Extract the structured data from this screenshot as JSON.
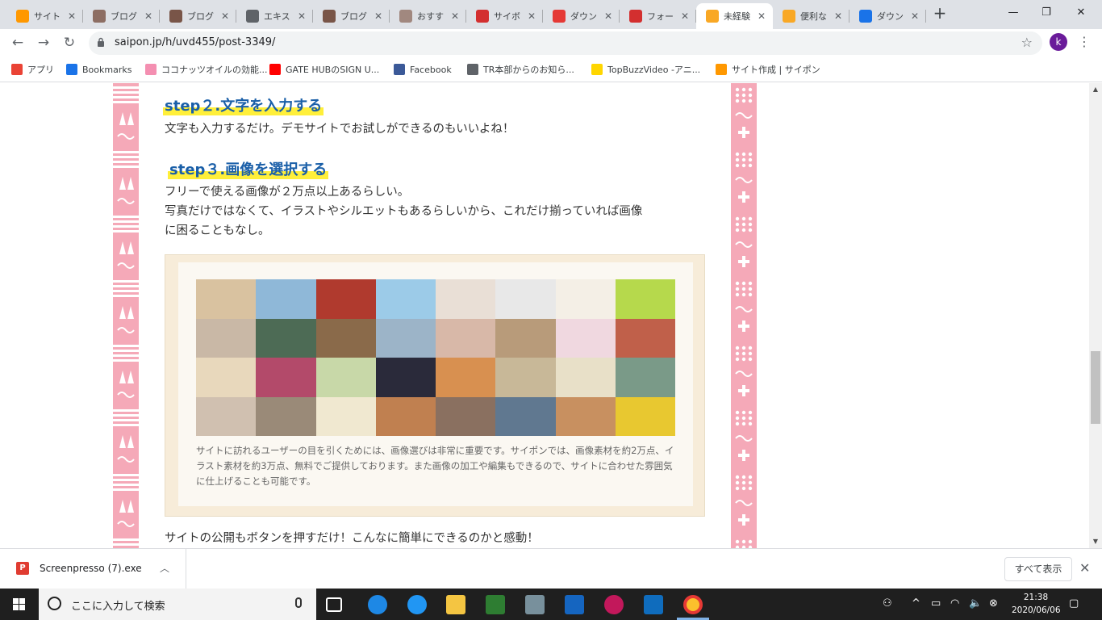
{
  "browser": {
    "tabs": [
      {
        "label": "サイト",
        "color": "#ff9800"
      },
      {
        "label": "ブログ",
        "color": "#8d6e63"
      },
      {
        "label": "ブログ",
        "color": "#795548"
      },
      {
        "label": "エキス",
        "color": "#5f6368"
      },
      {
        "label": "ブログ",
        "color": "#795548"
      },
      {
        "label": "おすす",
        "color": "#a1887f"
      },
      {
        "label": "サイボ",
        "color": "#d32f2f"
      },
      {
        "label": "ダウン",
        "color": "#e53935"
      },
      {
        "label": "フォー",
        "color": "#d32f2f"
      },
      {
        "label": "未経験",
        "color": "#f9a825",
        "active": true
      },
      {
        "label": "便利な",
        "color": "#f9a825"
      },
      {
        "label": "ダウン",
        "color": "#1a73e8"
      }
    ],
    "new_tab": "+",
    "window_controls": {
      "minimize": "—",
      "maximize": "❐",
      "close": "✕"
    },
    "url": "saipon.jp/h/uvd455/post-3349/",
    "profile_initial": "k",
    "bookmarks": [
      {
        "label": "アプリ",
        "icon": "apps-grid-icon",
        "color": "#ea4335"
      },
      {
        "label": "Bookmarks",
        "icon": "star-icon",
        "color": "#1a73e8"
      },
      {
        "label": "ココナッツオイルの効能...",
        "icon": "pig-icon",
        "color": "#f48fb1"
      },
      {
        "label": "GATE HUBのSIGN U...",
        "icon": "youtube-icon",
        "color": "#ff0000"
      },
      {
        "label": "Facebook",
        "icon": "facebook-icon",
        "color": "#3b5998"
      },
      {
        "label": "TR本部からのお知ら...",
        "icon": "globe-icon",
        "color": "#5f6368"
      },
      {
        "label": "TopBuzzVideo -アニ...",
        "icon": "topbuzz-icon",
        "color": "#ffd600"
      },
      {
        "label": "サイト作成 | サイポン",
        "icon": "saipon-icon",
        "color": "#ff9800"
      }
    ]
  },
  "article": {
    "step2_heading": "step２.文字を入力する",
    "step2_text": "文字も入力するだけ。デモサイトでお試しができるのもいいよね！",
    "step3_heading": "step３.画像を選択する",
    "step3_line1": "フリーで使える画像が２万点以上あるらしい。",
    "step3_line2": "写真だけではなくて、イラストやシルエットもあるらしいから、これだけ揃っていれば画像",
    "step3_line3": "に困ることもなし。",
    "figure_caption": "サイトに訪れるユーザーの目を引くためには、画像選びは非常に重要です。サイポンでは、画像素材を約2万点、イラスト素材を約3万点、無料でご提供しております。また画像の加工や編集もできるので、サイトに合わせた雰囲気に仕上げることも可能です。",
    "photo_colors": [
      "#d9c2a0",
      "#8fb8d8",
      "#b03a2e",
      "#9ccbe8",
      "#e9dfd6",
      "#e8e8e8",
      "#f4efe6",
      "#b6d94c",
      "#c9b8a6",
      "#4d6b55",
      "#8a6a4a",
      "#9cb4c8",
      "#d8b8a8",
      "#b89b7a",
      "#f0d8e0",
      "#c0604a",
      "#e8d8bc",
      "#b34a6a",
      "#c8d8a8",
      "#2a2a3a",
      "#d89050",
      "#c8b898",
      "#e8e0c8",
      "#7a9a88",
      "#d0c0b0",
      "#9a8a78",
      "#f0e8d0",
      "#c08050",
      "#8a7060",
      "#607890",
      "#c89060",
      "#e8c830"
    ],
    "after_text": "サイトの公開もボタンを押すだけ！こんなに簡単にできるのかと感動！"
  },
  "downloads": {
    "file_name": "Screenpresso (7).exe",
    "show_all": "すべて表示"
  },
  "taskbar": {
    "search_placeholder": "ここに入力して検索",
    "time": "21:38",
    "date": "2020/06/06"
  }
}
